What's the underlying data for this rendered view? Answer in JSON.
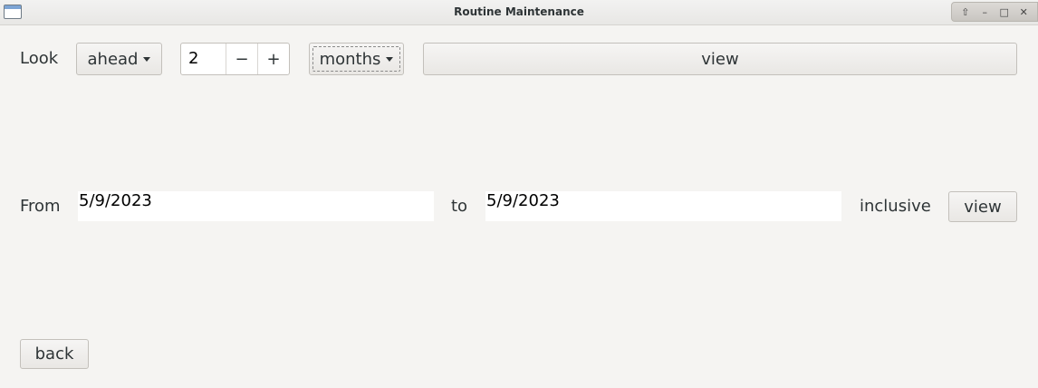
{
  "window": {
    "title": "Routine Maintenance"
  },
  "wm": {
    "up": "⇧",
    "minimize": "–",
    "maximize": "□",
    "close": "✕"
  },
  "row1": {
    "look_label": "Look",
    "direction": "ahead",
    "amount": "2",
    "minus": "−",
    "plus": "+",
    "unit": "months",
    "view_label": "view"
  },
  "row2": {
    "from_label": "From",
    "from_value": "5/9/2023",
    "to_label": "to",
    "to_value": "5/9/2023",
    "inclusive_label": "inclusive",
    "view_label": "view"
  },
  "footer": {
    "back_label": "back"
  }
}
